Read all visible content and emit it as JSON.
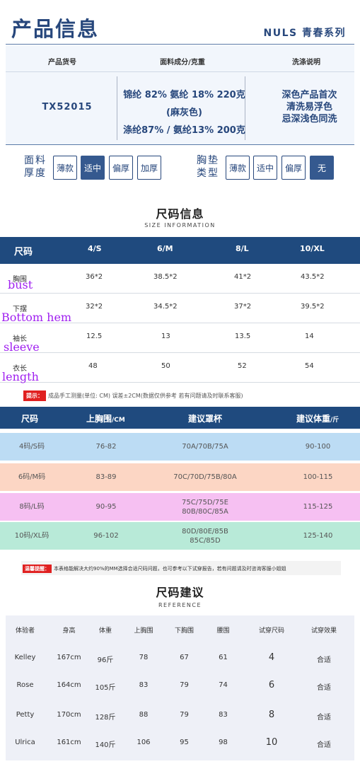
{
  "header": {
    "title": "产品信息",
    "series": "NULS 青春系列"
  },
  "product_table": {
    "headers": [
      "产品货号",
      "面料成分/克重",
      "洗涤说明"
    ],
    "code": "TX52015",
    "fabric": [
      "锦纶 82% 氨纶 18% 220克",
      "(麻灰色)",
      "涤纶87% / 氨纶13% 200克"
    ],
    "wash": [
      "深色产品首次",
      "清洗易浮色",
      "忌深浅色同洗"
    ]
  },
  "fabric_thickness": {
    "label": [
      "面料",
      "厚度"
    ],
    "options": [
      "薄款",
      "适中",
      "偏厚",
      "加厚"
    ],
    "selected": "适中"
  },
  "pad_type": {
    "label": [
      "胸垫",
      "类型"
    ],
    "options": [
      "薄款",
      "适中",
      "偏厚",
      "无"
    ],
    "selected": "无"
  },
  "size_info": {
    "title": "尺码信息",
    "subtitle": "SIZE INFORMATION",
    "columns": [
      "尺码",
      "4/S",
      "6/M",
      "8/L",
      "10/XL"
    ],
    "rows": [
      {
        "label": "胸围",
        "annotation": "bust",
        "values": [
          "36*2",
          "38.5*2",
          "41*2",
          "43.5*2"
        ]
      },
      {
        "label": "下摆",
        "annotation": "Bottom hem",
        "values": [
          "32*2",
          "34.5*2",
          "37*2",
          "39.5*2"
        ]
      },
      {
        "label": "袖长",
        "annotation": "sleeve",
        "values": [
          "12.5",
          "13",
          "13.5",
          "14"
        ]
      },
      {
        "label": "衣长",
        "annotation": "length",
        "values": [
          "48",
          "50",
          "52",
          "54"
        ]
      }
    ],
    "note_badge": "提示：",
    "note": "成品手工测量(单位: CM) 误差±2CM(数据仅供参考  若有问题请及时联系客服)"
  },
  "recommend_table": {
    "columns": [
      "尺码",
      "上胸围",
      "建议罩杯",
      "建议体重"
    ],
    "units": [
      "",
      "/CM",
      "",
      "/斤"
    ],
    "rows": [
      {
        "size": "4码/S码",
        "chest": "76-82",
        "cups": [
          "70A/70B/75A"
        ],
        "weight": "90-100",
        "color": "#bcdcf4"
      },
      {
        "size": "6码/M码",
        "chest": "83-89",
        "cups": [
          "70C/70D/75B/80A"
        ],
        "weight": "100-115",
        "color": "#fcd6c4"
      },
      {
        "size": "8码/L码",
        "chest": "90-95",
        "cups": [
          "75C/75D/75E",
          "80B/80C/85A"
        ],
        "weight": "115-125",
        "color": "#f6c0f2"
      },
      {
        "size": "10码/XL码",
        "chest": "96-102",
        "cups": [
          "80D/80E/85B",
          "85C/85D"
        ],
        "weight": "125-140",
        "color": "#b8ead8"
      }
    ],
    "note_badge": "温馨提醒：",
    "note": "本表格能解决大约90%的MM选择合适尺码问题，也可参考以下试穿报告，若有问题请及时咨询客服小姐姐"
  },
  "reference": {
    "title": "尺码建议",
    "subtitle": "REFERENCE",
    "columns": [
      "体验者",
      "身高",
      "体重",
      "上胸围",
      "下胸围",
      "腰围",
      "试穿尺码",
      "试穿效果"
    ],
    "rows": [
      [
        "Kelley",
        "167cm",
        "96斤",
        "78",
        "67",
        "61",
        "4",
        "合适"
      ],
      [
        "Rose",
        "164cm",
        "105斤",
        "83",
        "79",
        "74",
        "6",
        "合适"
      ],
      [
        "Petty",
        "170cm",
        "128斤",
        "88",
        "79",
        "83",
        "8",
        "合适"
      ],
      [
        "Ulrica",
        "161cm",
        "140斤",
        "106",
        "95",
        "98",
        "10",
        "合适"
      ]
    ]
  },
  "colors": {
    "navy": "#27477c",
    "table_header": "#1f4a7e",
    "annotation": "#a020f0",
    "warning": "#e02020"
  }
}
